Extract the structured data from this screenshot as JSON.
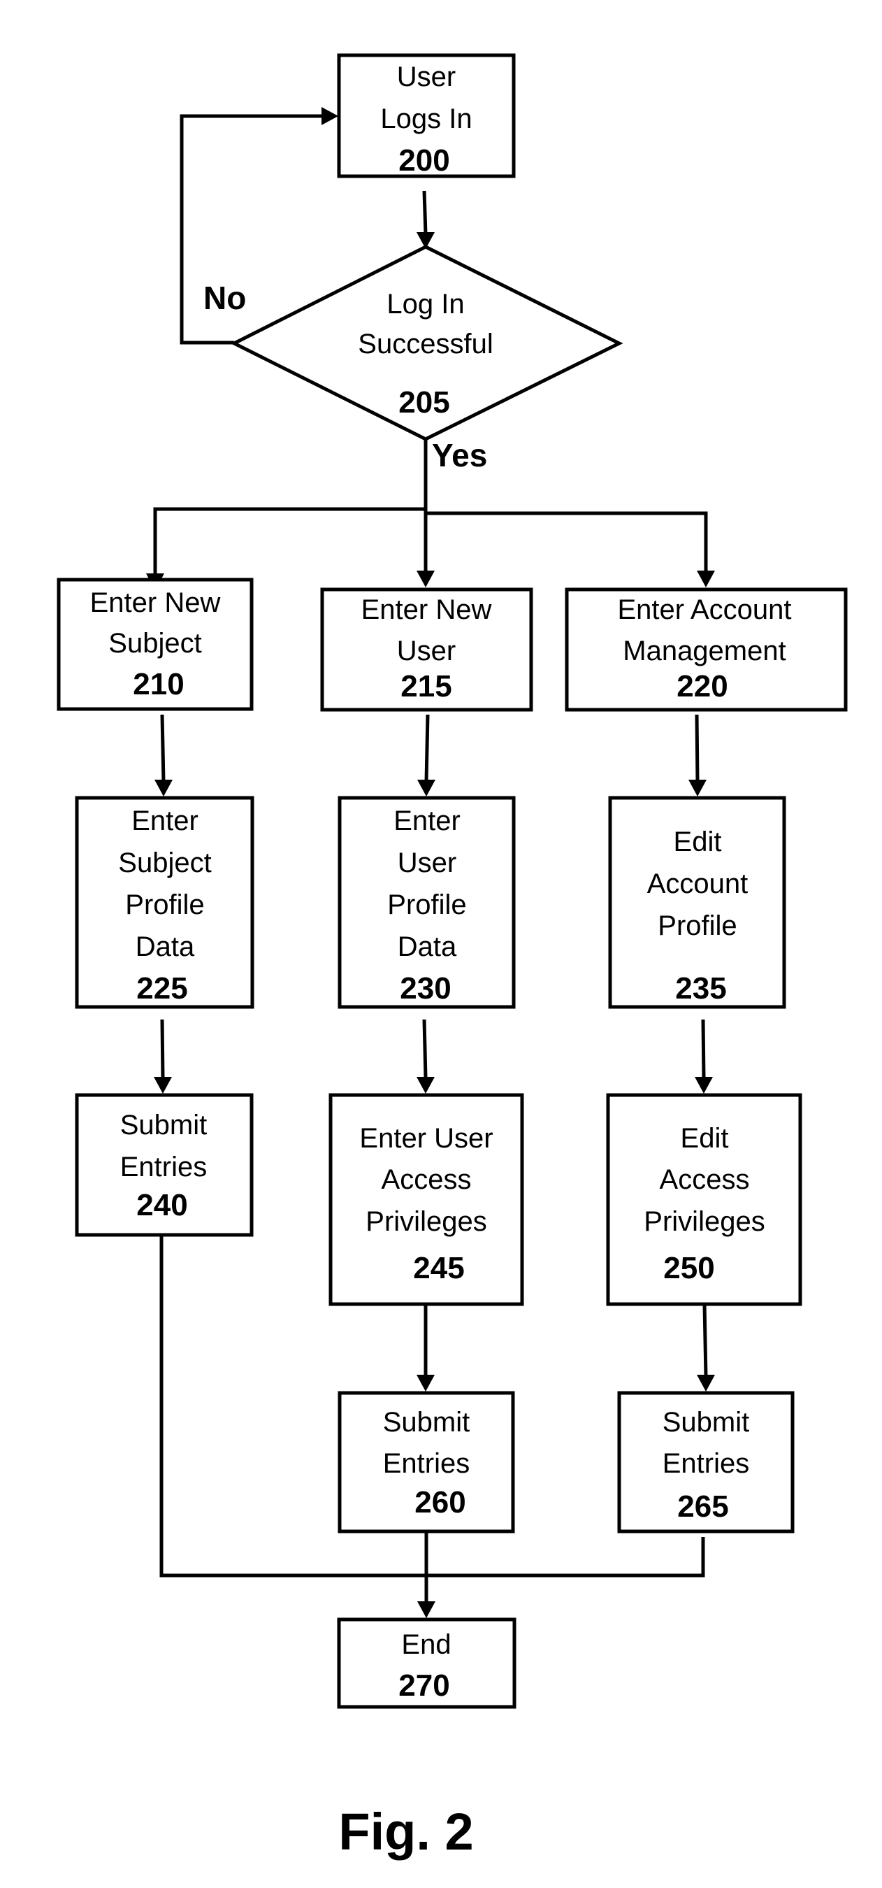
{
  "figure": {
    "caption": "Fig. 2",
    "branch_labels": {
      "no": "No",
      "yes": "Yes"
    },
    "colors": {
      "ink": "#000000",
      "background": "#ffffff"
    }
  },
  "nodes": {
    "n200": {
      "lines": [
        "User",
        "Logs In"
      ],
      "ref": "200",
      "type": "process"
    },
    "n205": {
      "lines": [
        "Log In",
        "Successful"
      ],
      "ref": "205",
      "type": "decision"
    },
    "n210": {
      "lines": [
        "Enter New",
        "Subject"
      ],
      "ref": "210",
      "type": "process"
    },
    "n215": {
      "lines": [
        "Enter New",
        "User"
      ],
      "ref": "215",
      "type": "process"
    },
    "n220": {
      "lines": [
        "Enter Account",
        "Management"
      ],
      "ref": "220",
      "type": "process"
    },
    "n225": {
      "lines": [
        "Enter",
        "Subject",
        "Profile",
        "Data"
      ],
      "ref": "225",
      "type": "process"
    },
    "n230": {
      "lines": [
        "Enter",
        "User",
        "Profile",
        "Data"
      ],
      "ref": "230",
      "type": "process"
    },
    "n235": {
      "lines": [
        "Edit",
        "Account",
        "Profile"
      ],
      "ref": "235",
      "type": "process"
    },
    "n240": {
      "lines": [
        "Submit",
        "Entries"
      ],
      "ref": "240",
      "type": "process"
    },
    "n245": {
      "lines": [
        "Enter User",
        "Access",
        "Privileges"
      ],
      "ref": "245",
      "type": "process"
    },
    "n250": {
      "lines": [
        "Edit",
        "Access",
        "Privileges"
      ],
      "ref": "250",
      "type": "process"
    },
    "n260": {
      "lines": [
        "Submit",
        "Entries"
      ],
      "ref": "260",
      "type": "process"
    },
    "n265": {
      "lines": [
        "Submit",
        "Entries"
      ],
      "ref": "265",
      "type": "process"
    },
    "n270": {
      "lines": [
        "End"
      ],
      "ref": "270",
      "type": "terminal"
    }
  },
  "edges": [
    {
      "from": "200",
      "to": "205"
    },
    {
      "from": "205",
      "to": "200",
      "label": "No"
    },
    {
      "from": "205",
      "to": "210",
      "label": "Yes"
    },
    {
      "from": "205",
      "to": "215",
      "label": "Yes"
    },
    {
      "from": "205",
      "to": "220",
      "label": "Yes"
    },
    {
      "from": "210",
      "to": "225"
    },
    {
      "from": "215",
      "to": "230"
    },
    {
      "from": "220",
      "to": "235"
    },
    {
      "from": "225",
      "to": "240"
    },
    {
      "from": "230",
      "to": "245"
    },
    {
      "from": "235",
      "to": "250"
    },
    {
      "from": "245",
      "to": "260"
    },
    {
      "from": "250",
      "to": "265"
    },
    {
      "from": "240",
      "to": "270"
    },
    {
      "from": "260",
      "to": "270"
    },
    {
      "from": "265",
      "to": "270"
    }
  ]
}
